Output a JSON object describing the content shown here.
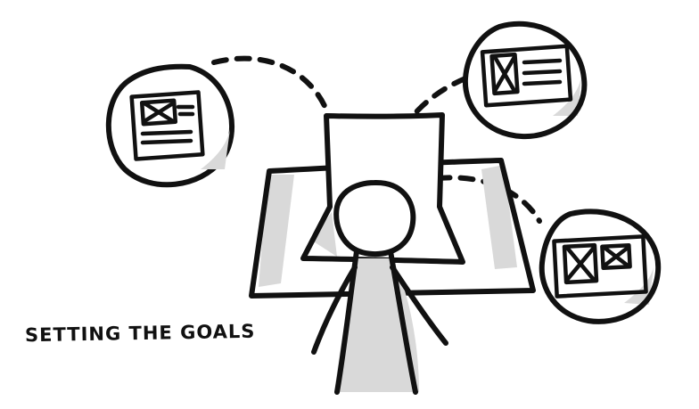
{
  "caption": "SETTING THE GOALS",
  "colors": {
    "ink": "#111111",
    "shade": "#d9d9d9",
    "paper": "#ffffff"
  },
  "icons": [
    "wireframe-card-left",
    "wireframe-card-top-right",
    "wireframe-card-bottom-right",
    "stick-figure",
    "desk",
    "paper-sheet"
  ]
}
